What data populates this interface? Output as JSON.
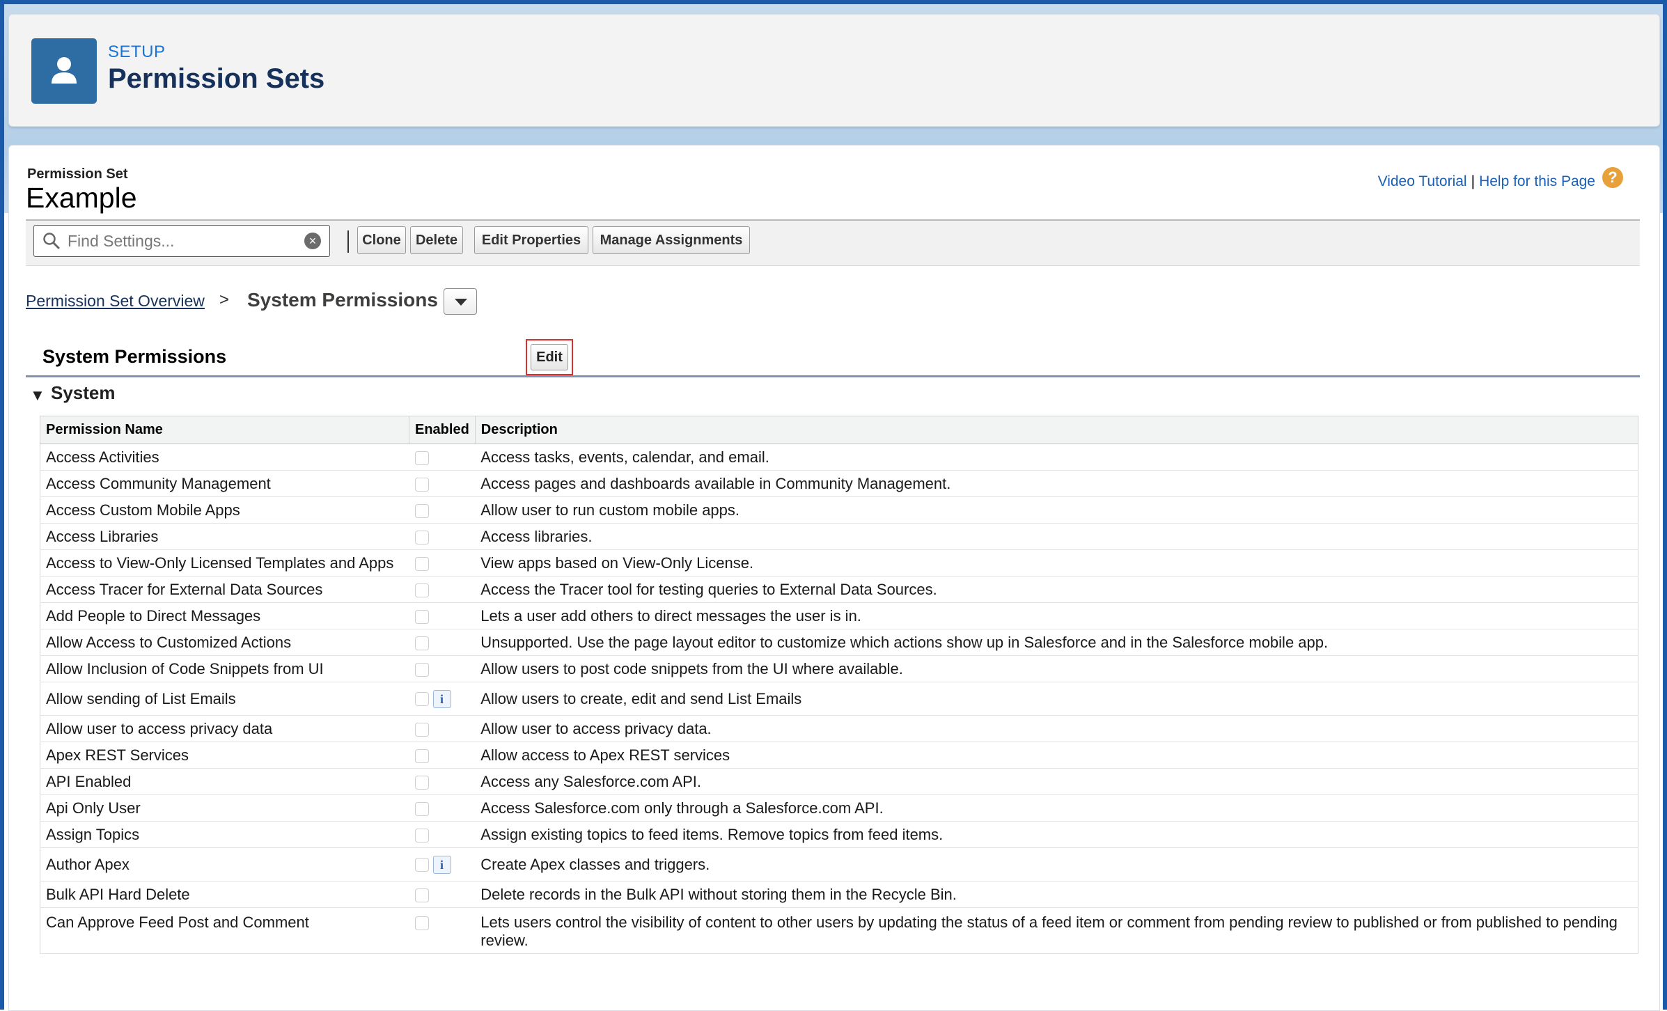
{
  "header": {
    "setup_label": "SETUP",
    "title": "Permission Sets",
    "icon": "user-icon"
  },
  "record": {
    "label": "Permission Set",
    "name": "Example"
  },
  "help": {
    "video_tutorial": "Video Tutorial",
    "separator": "|",
    "help_page": "Help for this Page",
    "help_icon": "?"
  },
  "toolbar": {
    "search_placeholder": "Find Settings...",
    "clone": "Clone",
    "delete": "Delete",
    "edit_properties": "Edit Properties",
    "manage_assignments": "Manage Assignments"
  },
  "breadcrumb": {
    "overview": "Permission Set Overview",
    "separator": ">",
    "current": "System Permissions"
  },
  "section": {
    "title": "System Permissions",
    "edit": "Edit",
    "group": "System"
  },
  "table": {
    "headers": [
      "Permission Name",
      "Enabled",
      "Description"
    ],
    "rows": [
      {
        "name": "Access Activities",
        "enabled": false,
        "info": false,
        "description": "Access tasks, events, calendar, and email."
      },
      {
        "name": "Access Community Management",
        "enabled": false,
        "info": false,
        "description": "Access pages and dashboards available in Community Management."
      },
      {
        "name": "Access Custom Mobile Apps",
        "enabled": false,
        "info": false,
        "description": "Allow user to run custom mobile apps."
      },
      {
        "name": "Access Libraries",
        "enabled": false,
        "info": false,
        "description": "Access libraries."
      },
      {
        "name": "Access to View-Only Licensed Templates and Apps",
        "enabled": false,
        "info": false,
        "description": "View apps based on View-Only License."
      },
      {
        "name": "Access Tracer for External Data Sources",
        "enabled": false,
        "info": false,
        "description": "Access the Tracer tool for testing queries to External Data Sources."
      },
      {
        "name": "Add People to Direct Messages",
        "enabled": false,
        "info": false,
        "description": "Lets a user add others to direct messages the user is in."
      },
      {
        "name": "Allow Access to Customized Actions",
        "enabled": false,
        "info": false,
        "description": "Unsupported. Use the page layout editor to customize which actions show up in Salesforce and in the Salesforce mobile app."
      },
      {
        "name": "Allow Inclusion of Code Snippets from UI",
        "enabled": false,
        "info": false,
        "description": "Allow users to post code snippets from the UI where available."
      },
      {
        "name": "Allow sending of List Emails",
        "enabled": false,
        "info": true,
        "description": "Allow users to create, edit and send List Emails"
      },
      {
        "name": "Allow user to access privacy data",
        "enabled": false,
        "info": false,
        "description": "Allow user to access privacy data."
      },
      {
        "name": "Apex REST Services",
        "enabled": false,
        "info": false,
        "description": "Allow access to Apex REST services"
      },
      {
        "name": "API Enabled",
        "enabled": false,
        "info": false,
        "description": "Access any Salesforce.com API."
      },
      {
        "name": "Api Only User",
        "enabled": false,
        "info": false,
        "description": "Access Salesforce.com only through a Salesforce.com API."
      },
      {
        "name": "Assign Topics",
        "enabled": false,
        "info": false,
        "description": "Assign existing topics to feed items. Remove topics from feed items."
      },
      {
        "name": "Author Apex",
        "enabled": false,
        "info": true,
        "description": "Create Apex classes and triggers."
      },
      {
        "name": "Bulk API Hard Delete",
        "enabled": false,
        "info": false,
        "description": "Delete records in the Bulk API without storing them in the Recycle Bin."
      },
      {
        "name": "Can Approve Feed Post and Comment",
        "enabled": false,
        "info": false,
        "description": "Lets users control the visibility of content to other users by updating the status of a feed item or comment from pending review to published or from published to pending review."
      }
    ]
  }
}
